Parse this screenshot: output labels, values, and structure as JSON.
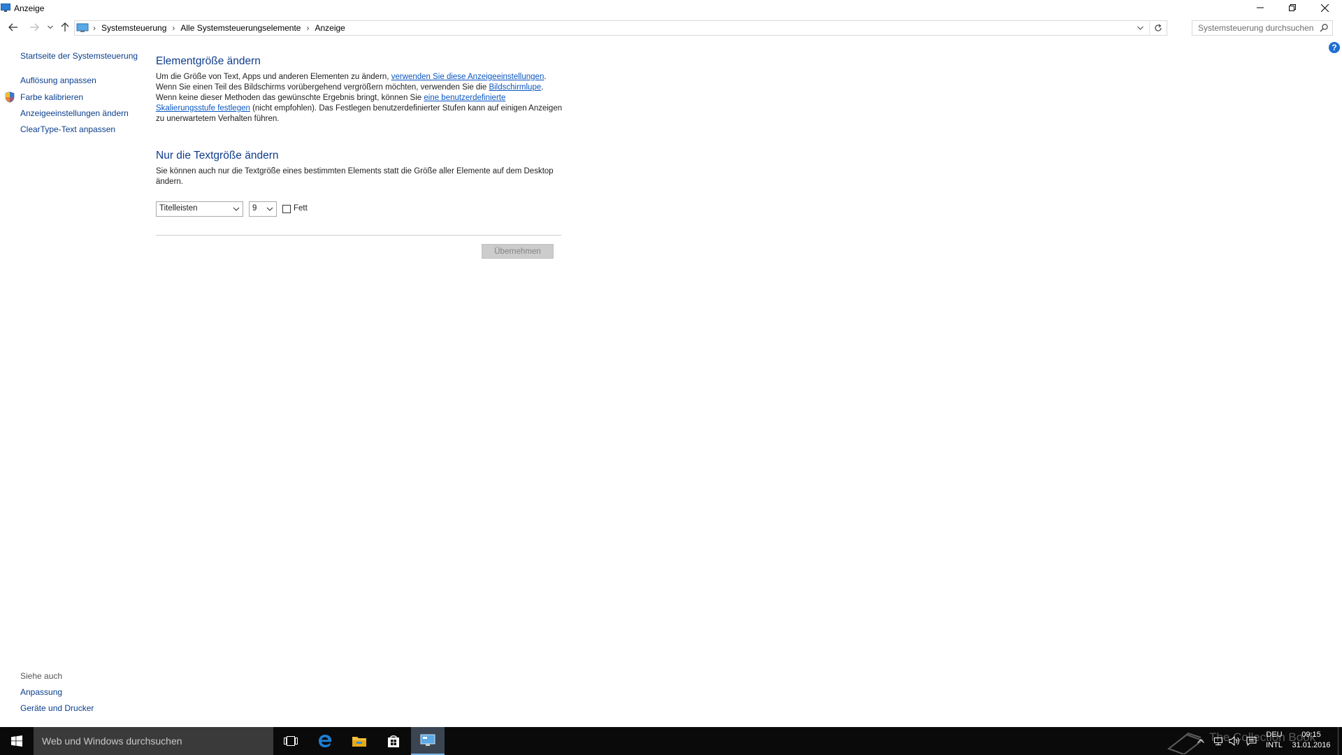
{
  "window": {
    "title": "Anzeige"
  },
  "breadcrumb": [
    "Systemsteuerung",
    "Alle Systemsteuerungselemente",
    "Anzeige"
  ],
  "search": {
    "placeholder": "Systemsteuerung durchsuchen"
  },
  "sidebar": {
    "home_link": "Startseite der Systemsteuerung",
    "items": [
      {
        "label": "Auflösung anpassen"
      },
      {
        "label": "Farbe kalibrieren"
      },
      {
        "label": "Anzeigeeinstellungen ändern"
      },
      {
        "label": "ClearType-Text anpassen"
      }
    ],
    "see_also": {
      "heading": "Siehe auch",
      "items": [
        {
          "label": "Anpassung"
        },
        {
          "label": "Geräte und Drucker"
        }
      ]
    }
  },
  "main": {
    "section1": {
      "title": "Elementgröße ändern",
      "t1": "Um die Größe von Text, Apps und anderen Elementen zu ändern, ",
      "link1": "verwenden Sie diese Anzeigeeinstellungen",
      "t2": ".",
      "t3": "Wenn Sie einen Teil des Bildschirms vorübergehend vergrößern möchten, verwenden Sie die ",
      "link2": "Bildschirmlupe",
      "t4": ".",
      "t5": "Wenn keine dieser Methoden das gewünschte Ergebnis bringt, können Sie ",
      "link3": "eine benutzerdefinierte Skalierungsstufe festlegen",
      "t6": " (nicht empfohlen). Das Festlegen benutzerdefinierter Stufen kann auf einigen Anzeigen zu unerwartetem Verhalten führen."
    },
    "section2": {
      "title": "Nur die Textgröße ändern",
      "text": "Sie können auch nur die Textgröße eines bestimmten Elements statt die Größe aller Elemente auf dem Desktop ändern.",
      "element_select": "Titelleisten",
      "size_select": "9",
      "bold_label": "Fett",
      "bold_checked": false,
      "apply_button": "Übernehmen"
    }
  },
  "taskbar": {
    "search_placeholder": "Web und Windows durchsuchen",
    "lang_top": "DEU",
    "lang_bottom": "INTL",
    "time": "09:15",
    "date": "31.01.2016",
    "watermark": "The Collection Book"
  },
  "colors": {
    "link": "#0b3f8c",
    "heading": "#0f3c8c",
    "taskbar": "#0a0a0a"
  }
}
